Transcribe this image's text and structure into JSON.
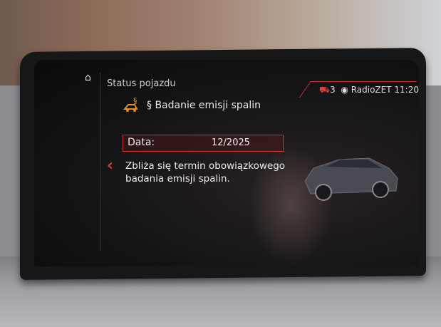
{
  "screen": {
    "title": "Status pojazdu",
    "status_bar": {
      "notification_count": "3",
      "radio_station": "RadioZET",
      "time": "11:20"
    },
    "item": {
      "title": "§ Badanie emisji spalin",
      "data_label": "Data:",
      "data_value": "12/2025",
      "message": "Zbliża się termin obowiązkowego badania emisji spalin."
    }
  },
  "icons": {
    "home": "home-icon",
    "warning": "emission-warning-icon",
    "back": "chevron-left-icon",
    "radio": "radio-icon",
    "car": "car-icon"
  },
  "colors": {
    "accent_red": "#c73a32",
    "warning_orange": "#e38a2b",
    "screen_bg": "#141416",
    "text": "#e9e9ea"
  }
}
